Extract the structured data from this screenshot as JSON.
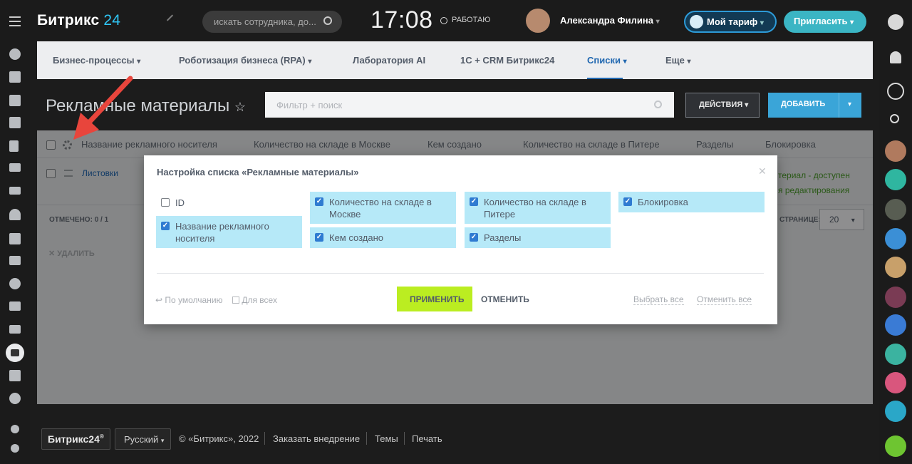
{
  "app": {
    "logo_text": "Битрикс",
    "logo_num": "24"
  },
  "header": {
    "search_placeholder": "искать сотрудника, до...",
    "time": "17:08",
    "status": "РАБОТАЮ",
    "user_name": "Александра Филина",
    "tariff_label": "Мой тариф",
    "invite_label": "Пригласить"
  },
  "nav": {
    "items": [
      {
        "label": "Бизнес-процессы"
      },
      {
        "label": "Роботизация бизнеса (RPA)"
      },
      {
        "label": "Лаборатория AI"
      },
      {
        "label": "1С + CRM Битрикс24"
      },
      {
        "label": "Списки"
      },
      {
        "label": "Еще"
      }
    ]
  },
  "page": {
    "title": "Рекламные материалы",
    "filter_placeholder": "Фильтр + поиск",
    "actions_label": "ДЕЙСТВИЯ",
    "add_label": "ДОБАВИТЬ"
  },
  "grid": {
    "headers": [
      "Название рекламного носителя",
      "Количество на складе в Москве",
      "Кем создано",
      "Количество на складе в Питере",
      "Разделы",
      "Блокировка"
    ],
    "row1_name": "Листовки",
    "row1_right_line1": "териал - доступен",
    "row1_right_line2": "я редактирования",
    "marked": "ОТМЕЧЕНО: 0 / 1",
    "per_page_label": "СТРАНИЦЕ:",
    "per_page_value": "20",
    "delete_label": "УДАЛИТЬ"
  },
  "modal": {
    "title": "Настройка списка «Рекламные материалы»",
    "options": [
      {
        "label": "ID",
        "checked": false
      },
      {
        "label": "Название рекламного носителя",
        "checked": true
      },
      {
        "label": "Количество на складе в Москве",
        "checked": true
      },
      {
        "label": "Кем создано",
        "checked": true
      },
      {
        "label": "Количество на складе в Питере",
        "checked": true
      },
      {
        "label": "Разделы",
        "checked": true
      },
      {
        "label": "Блокировка",
        "checked": true
      }
    ],
    "default_label": "По умолчанию",
    "for_all_label": "Для всех",
    "apply_label": "ПРИМЕНИТЬ",
    "cancel_label": "ОТМЕНИТЬ",
    "select_all_label": "Выбрать все",
    "deselect_all_label": "Отменить все"
  },
  "footer": {
    "logo": "Битрикс24",
    "language": "Русский",
    "copyright": "© «Битрикс», 2022",
    "order_link": "Заказать внедрение",
    "themes_link": "Темы",
    "print_link": "Печать"
  },
  "colors": {
    "accent": "#2fc6f6",
    "active_nav": "#2067b0",
    "option_bg": "#b6e9f8",
    "apply_btn": "#bbed21",
    "arrow": "#e8453c"
  }
}
